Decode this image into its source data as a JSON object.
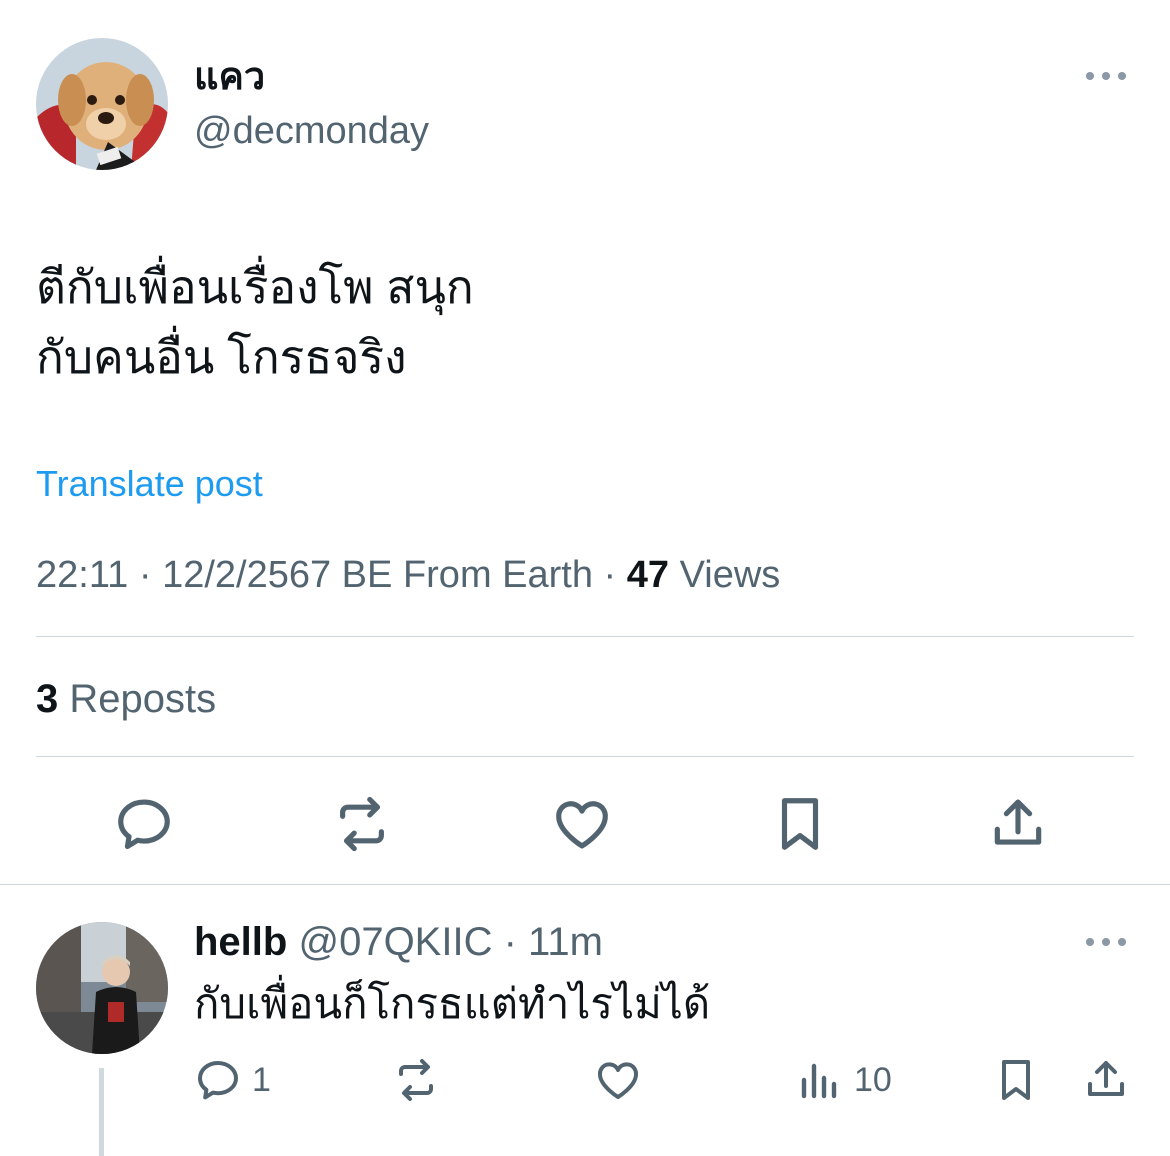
{
  "post": {
    "display_name": "แคว",
    "handle": "@decmonday",
    "text": "ตีกับเพื่อนเรื่องโพ สนุก\nกับคนอื่น โกรธจริง",
    "translate_label": "Translate post",
    "time": "22:11",
    "date": "12/2/2567 BE",
    "source": "From Earth",
    "views_count": "47",
    "views_label": "Views",
    "reposts_count": "3",
    "reposts_label": "Reposts"
  },
  "actions": [
    "reply-icon",
    "repost-icon",
    "like-icon",
    "bookmark-icon",
    "share-icon"
  ],
  "reply": {
    "display_name": "hellb",
    "handle": "@07QKIIC",
    "time": "11m",
    "text": "กับเพื่อนก็โกรธแต่ทำไรไม่ได้",
    "reply_count": "1",
    "views_count": "10"
  },
  "colors": {
    "text": "#0f1419",
    "secondary": "#536471",
    "accent": "#1d9bf0",
    "divider": "#cfd9de"
  }
}
